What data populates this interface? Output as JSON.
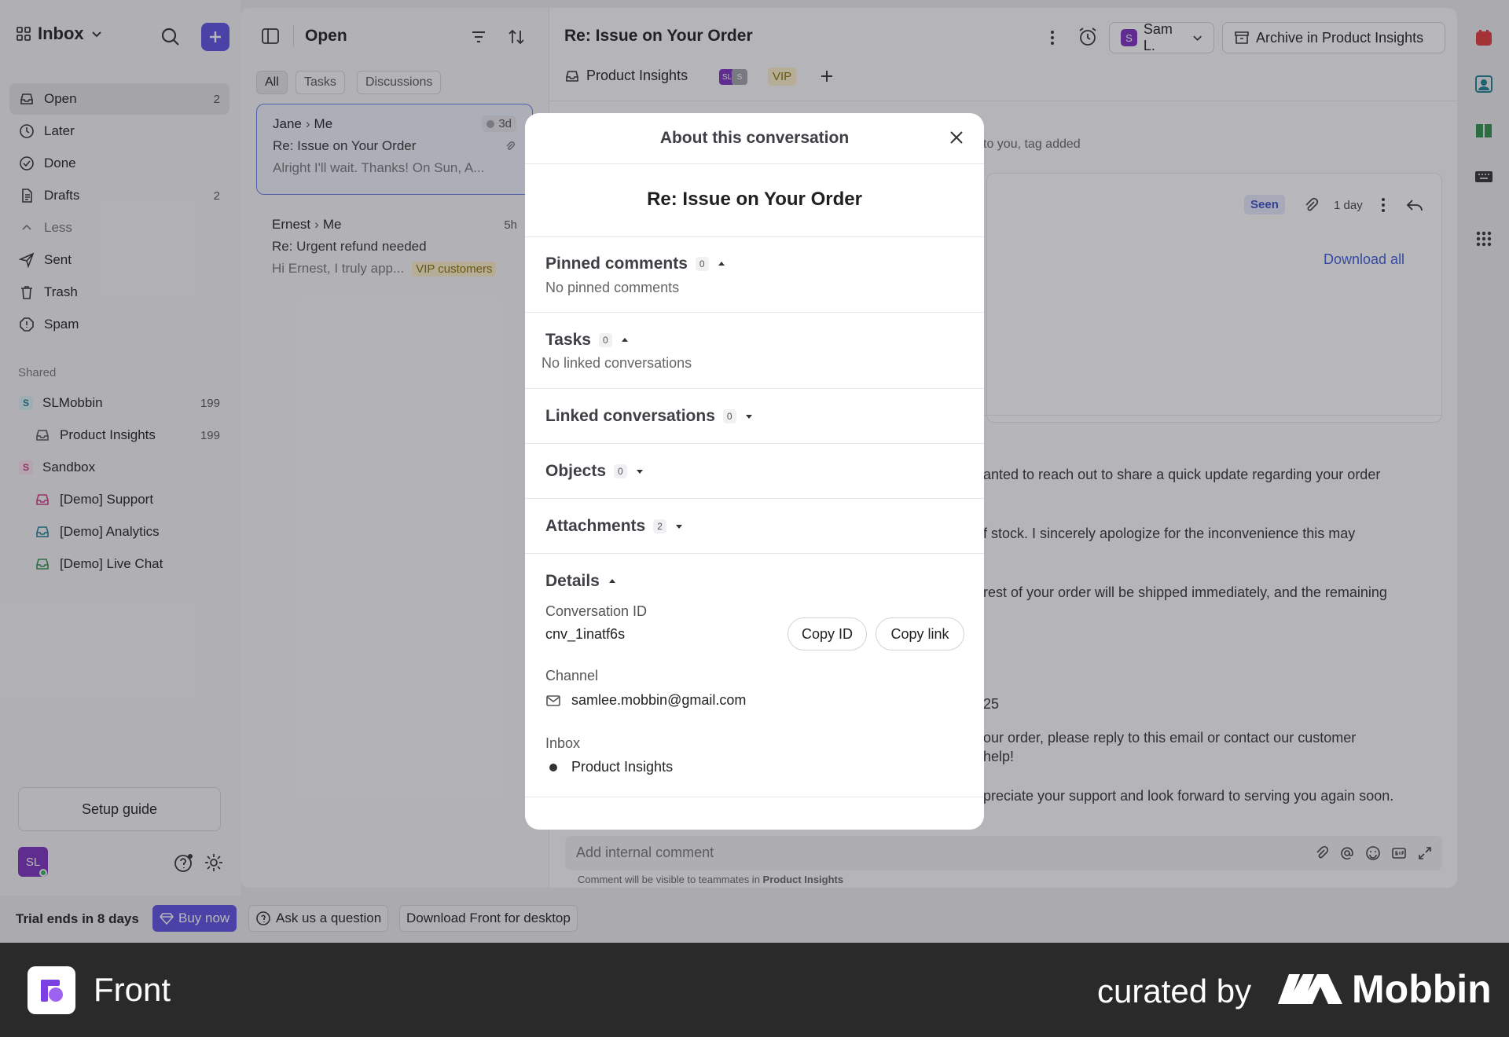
{
  "sidebar": {
    "inbox_label": "Inbox",
    "items": [
      {
        "label": "Open",
        "count": "2"
      },
      {
        "label": "Later",
        "count": ""
      },
      {
        "label": "Done",
        "count": ""
      },
      {
        "label": "Drafts",
        "count": "2"
      },
      {
        "label": "Less",
        "count": ""
      },
      {
        "label": "Sent",
        "count": ""
      },
      {
        "label": "Trash",
        "count": ""
      },
      {
        "label": "Spam",
        "count": ""
      }
    ],
    "shared_label": "Shared",
    "shared": [
      {
        "label": "SLMobbin",
        "count": "199",
        "badge": "S"
      },
      {
        "label": "Product Insights",
        "count": "199"
      },
      {
        "label": "Sandbox",
        "count": "",
        "badge": "S"
      },
      {
        "label": "[Demo] Support",
        "count": ""
      },
      {
        "label": "[Demo] Analytics",
        "count": ""
      },
      {
        "label": "[Demo] Live Chat",
        "count": ""
      }
    ],
    "setup_guide": "Setup guide",
    "avatar": "SL"
  },
  "list": {
    "title": "Open",
    "filters": [
      "All",
      "Tasks",
      "Discussions"
    ],
    "conversations": [
      {
        "from": "Jane",
        "to": "Me",
        "time": "3d",
        "subject": "Re: Issue on Your Order",
        "preview": "Alright I'll wait. Thanks! On Sun, A...",
        "tag": ""
      },
      {
        "from": "Ernest",
        "to": "Me",
        "time": "5h",
        "subject": "Re: Urgent refund needed",
        "preview": "Hi Ernest, I truly app...",
        "tag": "VIP customers"
      }
    ]
  },
  "main": {
    "title": "Re: Issue on Your Order",
    "assignee": "Sam L.",
    "assignee_badge": "S",
    "archive_label": "Archive in Product Insights",
    "inbox_tag": "Product Insights",
    "avatars": [
      "SL",
      "S"
    ],
    "vip_tag": "VIP",
    "activity": "to you, tag added",
    "seen": "Seen",
    "age": "1 day",
    "download_all": "Download all",
    "body_lines": [
      "anted to reach out to share a quick update regarding your order",
      "f stock. I sincerely apologize for the inconvenience this may",
      "rest of your order will be shipped immediately, and the remaining",
      "25",
      "our order, please reply to this email or contact our customer",
      "help!",
      "preciate your support and look forward to serving you again soon."
    ],
    "comment_placeholder": "Add internal comment",
    "comment_note_prefix": "Comment will be visible to teammates in",
    "comment_note_inbox": "Product Insights"
  },
  "modal": {
    "title": "About this conversation",
    "subject": "Re: Issue on Your Order",
    "pinned": {
      "label": "Pinned comments",
      "count": "0",
      "empty": "No pinned comments"
    },
    "tasks": {
      "label": "Tasks",
      "count": "0",
      "empty": "No linked conversations"
    },
    "linked": {
      "label": "Linked conversations",
      "count": "0"
    },
    "objects": {
      "label": "Objects",
      "count": "0"
    },
    "attachments": {
      "label": "Attachments",
      "count": "2"
    },
    "details": {
      "label": "Details",
      "conv_id_label": "Conversation ID",
      "conv_id": "cnv_1inatf6s",
      "copy_id": "Copy ID",
      "copy_link": "Copy link",
      "channel_label": "Channel",
      "channel": "samlee.mobbin@gmail.com",
      "inbox_label": "Inbox",
      "inbox": "Product Insights"
    }
  },
  "trial": {
    "text": "Trial ends in 8 days",
    "buy": "Buy now",
    "ask": "Ask us a question",
    "download": "Download Front for desktop"
  },
  "footer": {
    "app": "Front",
    "curated": "curated by",
    "brand": "Mobbin"
  },
  "colors": {
    "accent": "#5b4fe0",
    "vip_bg": "#fbefc6",
    "seen_bg": "#e6e9fb",
    "link": "#3b5bdb"
  }
}
